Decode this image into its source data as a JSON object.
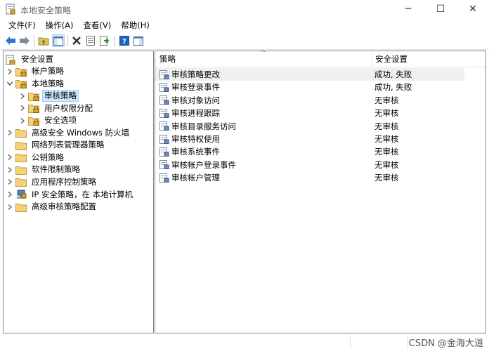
{
  "window": {
    "title": "本地安全策略",
    "minimize_glyph": "─",
    "maximize_glyph": "☐",
    "close_glyph": "✕"
  },
  "menu": [
    "文件(F)",
    "操作(A)",
    "查看(V)",
    "帮助(H)"
  ],
  "toolbar": {
    "buttons": [
      "back-icon",
      "forward-icon",
      "up-folder-icon",
      "show-hide-tree-icon",
      "delete-icon",
      "properties-icon",
      "export-list-icon",
      "help-icon",
      "console-view-icon"
    ]
  },
  "tree": {
    "root": "安全设置",
    "items": [
      {
        "label": "帐户策略",
        "level": 1,
        "expander": "collapsed",
        "icon": "folder-lock-icon"
      },
      {
        "label": "本地策略",
        "level": 1,
        "expander": "expanded",
        "icon": "folder-lock-icon"
      },
      {
        "label": "审核策略",
        "level": 2,
        "expander": "collapsed",
        "icon": "folder-lock-icon",
        "selected": true
      },
      {
        "label": "用户权限分配",
        "level": 2,
        "expander": "collapsed",
        "icon": "folder-lock-icon"
      },
      {
        "label": "安全选项",
        "level": 2,
        "expander": "collapsed",
        "icon": "folder-lock-icon"
      },
      {
        "label": "高级安全 Windows 防火墙",
        "level": 1,
        "expander": "collapsed",
        "icon": "folder-icon"
      },
      {
        "label": "网络列表管理器策略",
        "level": 1,
        "expander": "none",
        "icon": "folder-icon"
      },
      {
        "label": "公钥策略",
        "level": 1,
        "expander": "collapsed",
        "icon": "folder-icon"
      },
      {
        "label": "软件限制策略",
        "level": 1,
        "expander": "collapsed",
        "icon": "folder-icon"
      },
      {
        "label": "应用程序控制策略",
        "level": 1,
        "expander": "collapsed",
        "icon": "folder-icon"
      },
      {
        "label": "IP 安全策略，在 本地计算机",
        "level": 1,
        "expander": "collapsed",
        "icon": "ip-security-icon"
      },
      {
        "label": "高级审核策略配置",
        "level": 1,
        "expander": "collapsed",
        "icon": "folder-icon"
      }
    ]
  },
  "list": {
    "columns": [
      "策略",
      "安全设置"
    ],
    "rows": [
      {
        "policy": "审核策略更改",
        "setting": "成功, 失败"
      },
      {
        "policy": "审核登录事件",
        "setting": "成功, 失败"
      },
      {
        "policy": "审核对象访问",
        "setting": "无审核"
      },
      {
        "policy": "审核进程跟踪",
        "setting": "无审核"
      },
      {
        "policy": "审核目录服务访问",
        "setting": "无审核"
      },
      {
        "policy": "审核特权使用",
        "setting": "无审核"
      },
      {
        "policy": "审核系统事件",
        "setting": "无审核"
      },
      {
        "policy": "审核帐户登录事件",
        "setting": "无审核"
      },
      {
        "policy": "审核帐户管理",
        "setting": "无审核"
      }
    ]
  },
  "watermark": "CSDN @金海大道"
}
